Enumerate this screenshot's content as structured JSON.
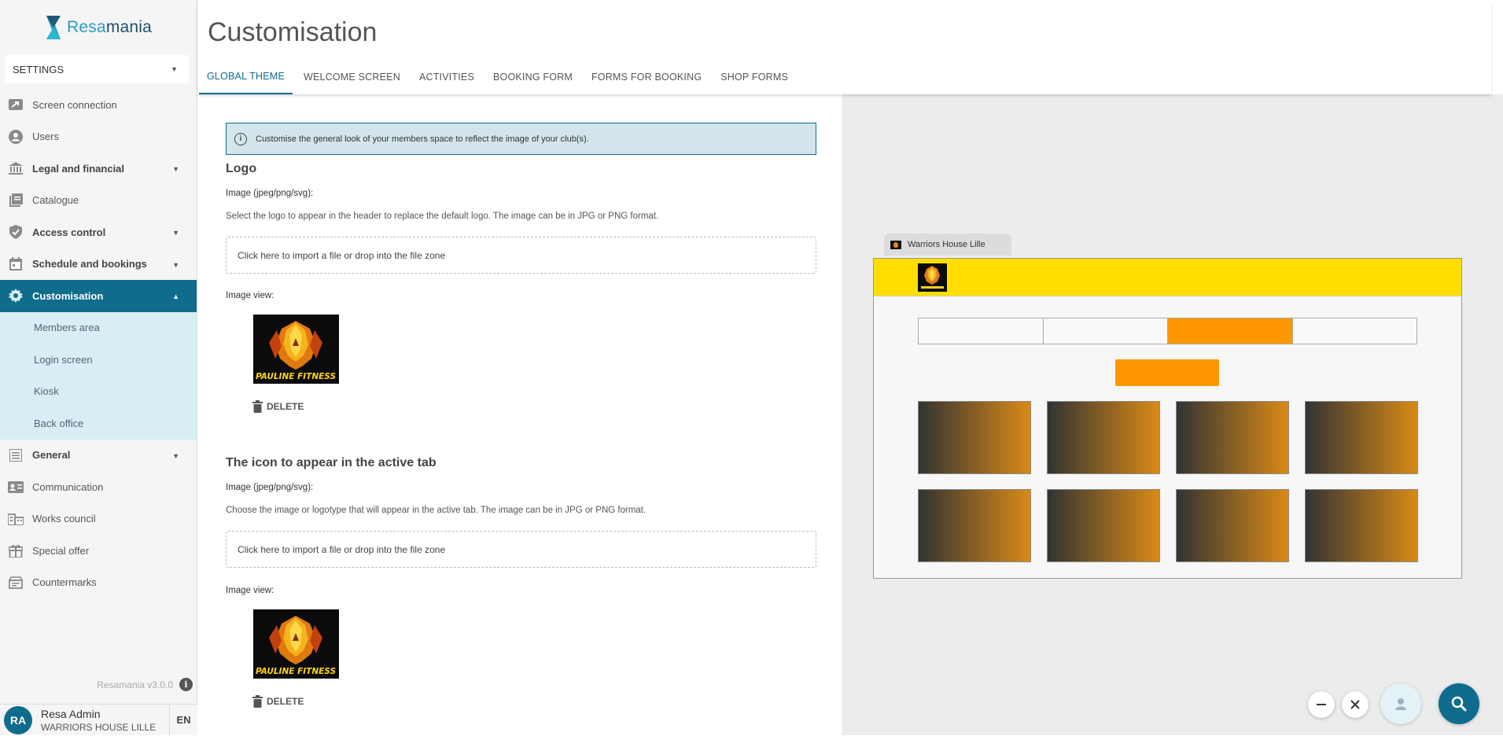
{
  "brand": {
    "name_part1": "Resa",
    "name_part2": "mania"
  },
  "sidebar": {
    "settings_label": "SETTINGS",
    "items": [
      {
        "label": "Screen connection",
        "icon": "screen-connection-icon",
        "bold": false,
        "caret": false
      },
      {
        "label": "Users",
        "icon": "user-circle-icon",
        "bold": false,
        "caret": false
      },
      {
        "label": "Legal and financial",
        "icon": "bank-icon",
        "bold": true,
        "caret": true
      },
      {
        "label": "Catalogue",
        "icon": "catalogue-icon",
        "bold": false,
        "caret": false
      },
      {
        "label": "Access control",
        "icon": "shield-check-icon",
        "bold": true,
        "caret": true
      },
      {
        "label": "Schedule and bookings",
        "icon": "calendar-icon",
        "bold": true,
        "caret": true
      },
      {
        "label": "Customisation",
        "icon": "gear-icon",
        "bold": true,
        "caret": true,
        "active": true
      }
    ],
    "subitems": [
      "Members area",
      "Login screen",
      "Kiosk",
      "Back office"
    ],
    "items_after": [
      {
        "label": "General",
        "icon": "list-icon",
        "bold": true,
        "caret": true
      },
      {
        "label": "Communication",
        "icon": "contact-card-icon",
        "bold": false,
        "caret": false
      },
      {
        "label": "Works council",
        "icon": "building-icon",
        "bold": false,
        "caret": false
      },
      {
        "label": "Special offer",
        "icon": "gift-icon",
        "bold": false,
        "caret": false
      },
      {
        "label": "Countermarks",
        "icon": "ticket-icon",
        "bold": false,
        "caret": false
      }
    ],
    "version": "Resamania v3.0.0",
    "user": {
      "initials": "RA",
      "name": "Resa Admin",
      "club": "WARRIORS HOUSE LILLE",
      "lang": "EN"
    }
  },
  "header": {
    "title": "Customisation",
    "tabs": [
      "GLOBAL THEME",
      "WELCOME SCREEN",
      "ACTIVITIES",
      "BOOKING FORM",
      "FORMS FOR BOOKING",
      "SHOP FORMS"
    ],
    "active_tab": 0
  },
  "form": {
    "info": "Customise the general look of your members space to reflect the image of your club(s).",
    "logo": {
      "title": "Logo",
      "label": "Image (jpeg/png/svg):",
      "description": "Select the logo to appear in the header to replace the default logo. The image can be in JPG or PNG format.",
      "dropzone": "Click here to import a file or drop into the file zone",
      "preview_label": "Image view:",
      "image_text": "PAULINE FITNESS",
      "delete": "DELETE"
    },
    "tab_icon": {
      "title": "The icon to appear in the active tab",
      "label": "Image (jpeg/png/svg):",
      "description": "Choose the image or logotype that will appear in the active tab. The image can be in JPG or PNG format.",
      "dropzone": "Click here to import a file or drop into the file zone",
      "preview_label": "Image view:",
      "image_text": "PAULINE FITNESS",
      "delete": "DELETE"
    }
  },
  "preview": {
    "tab_title": "Warriors House Lille",
    "colors": {
      "header": "#ffde00",
      "accent": "#ff9800",
      "card_from": "#333333",
      "card_to": "#d98a16"
    },
    "cards_count": 8,
    "active_segment": 2
  },
  "colors": {
    "primary": "#0f6c8d",
    "sidebar_sub_bg": "#d9edf5",
    "banner_bg": "#d3e5ea"
  },
  "fab": {
    "minimize_icon": "minus-icon",
    "close_icon": "close-icon",
    "user_icon": "person-icon",
    "search_icon": "search-icon"
  }
}
